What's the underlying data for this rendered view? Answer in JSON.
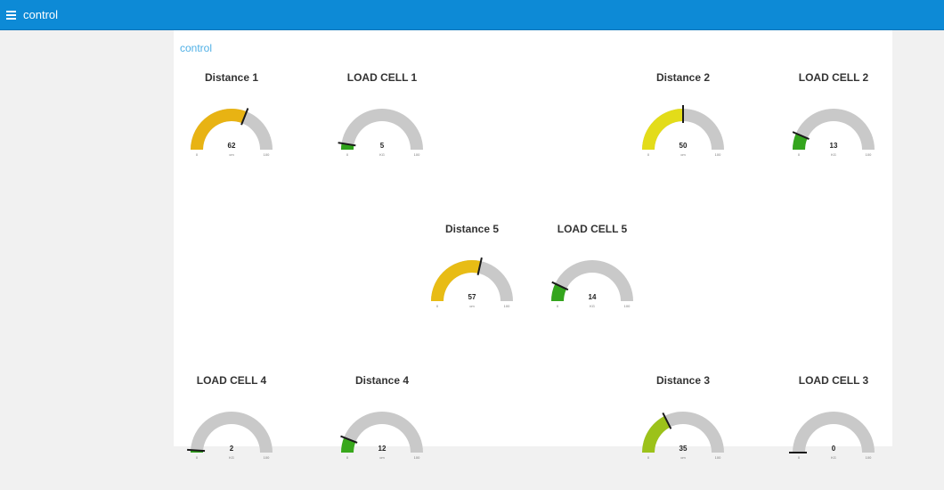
{
  "app": {
    "title": "control",
    "menu_icon": "hamburger-menu-icon"
  },
  "group": {
    "title": "control"
  },
  "colors": {
    "topbar": "#0d8ad6",
    "track": "#c9c9c9",
    "needle": "#1a1a1a",
    "group_title": "#4fb0e6"
  },
  "gauges": [
    {
      "id": "distance-1",
      "title": "Distance 1",
      "value": 62,
      "min": 0,
      "max": 100,
      "unit": "cm",
      "color": "#e8b313"
    },
    {
      "id": "load-cell-1",
      "title": "LOAD CELL 1",
      "value": 5,
      "min": 0,
      "max": 100,
      "unit": "KG",
      "color": "#2ea21a"
    },
    {
      "id": "distance-2",
      "title": "Distance 2",
      "value": 50,
      "min": 0,
      "max": 100,
      "unit": "cm",
      "color": "#e3dc19"
    },
    {
      "id": "load-cell-2",
      "title": "LOAD CELL 2",
      "value": 13,
      "min": 0,
      "max": 100,
      "unit": "KG",
      "color": "#34a51d"
    },
    {
      "id": "distance-5",
      "title": "Distance 5",
      "value": 57,
      "min": 0,
      "max": 100,
      "unit": "cm",
      "color": "#e8bc15"
    },
    {
      "id": "load-cell-5",
      "title": "LOAD CELL 5",
      "value": 14,
      "min": 0,
      "max": 100,
      "unit": "KG",
      "color": "#34a51d"
    },
    {
      "id": "load-cell-4",
      "title": "LOAD CELL 4",
      "value": 2,
      "min": 0,
      "max": 100,
      "unit": "KG",
      "color": "#2ea21a"
    },
    {
      "id": "distance-4",
      "title": "Distance 4",
      "value": 12,
      "min": 0,
      "max": 100,
      "unit": "cm",
      "color": "#39a81c"
    },
    {
      "id": "distance-3",
      "title": "Distance 3",
      "value": 35,
      "min": 0,
      "max": 100,
      "unit": "cm",
      "color": "#9cc21a"
    },
    {
      "id": "load-cell-3",
      "title": "LOAD CELL 3",
      "value": 0,
      "min": 0,
      "max": 100,
      "unit": "KG",
      "color": "#2ea21a"
    }
  ]
}
